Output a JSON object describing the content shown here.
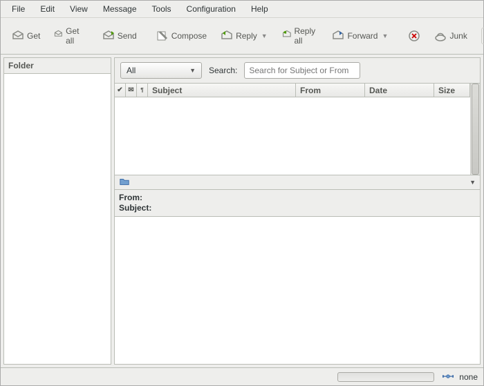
{
  "menu": {
    "file": "File",
    "edit": "Edit",
    "view": "View",
    "message": "Message",
    "tools": "Tools",
    "config": "Configuration",
    "help": "Help"
  },
  "toolbar": {
    "get": "Get",
    "get_all": "Get all",
    "send": "Send",
    "compose": "Compose",
    "reply": "Reply",
    "reply_all": "Reply all",
    "forward": "Forward",
    "junk": "Junk"
  },
  "folder": {
    "header": "Folder"
  },
  "filter": {
    "selected": "All",
    "search_label": "Search:",
    "search_placeholder": "Search for Subject or From"
  },
  "columns": {
    "check": "✔",
    "msg": "✉",
    "att": "📎",
    "subject": "Subject",
    "from": "From",
    "date": "Date",
    "size": "Size"
  },
  "preview": {
    "from": "From:",
    "subject": "Subject:"
  },
  "status": {
    "conn": "none"
  }
}
